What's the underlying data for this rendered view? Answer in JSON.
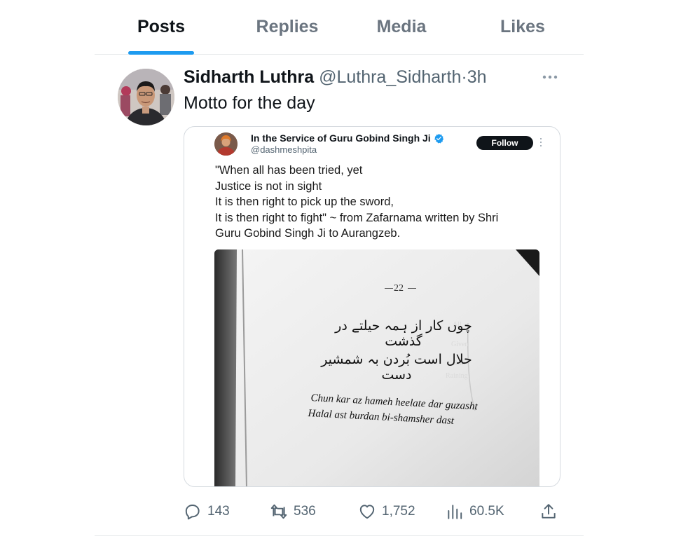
{
  "tabs": [
    {
      "label": "Posts",
      "active": true
    },
    {
      "label": "Replies",
      "active": false
    },
    {
      "label": "Media",
      "active": false
    },
    {
      "label": "Likes",
      "active": false
    }
  ],
  "accent_color": "#1d9bf0",
  "post": {
    "author_name": "Sidharth Luthra",
    "author_handle": "@Luthra_Sidharth",
    "separator": "·",
    "time": "3h",
    "text": "Motto for the day",
    "more_icon": "more-horizontal-icon"
  },
  "quoted_post": {
    "author_name": "In the Service of Guru Gobind Singh Ji",
    "author_handle": "@dashmeshpita",
    "verified_icon": "verified-badge-icon",
    "follow_label": "Follow",
    "text_lines": [
      "\"When all has been tried, yet",
      "Justice is not in sight",
      "It is then right to pick up the sword,",
      "It is then right to fight\" ~ from Zafarnama written by Shri",
      "Guru Gobind Singh Ji to Aurangzeb."
    ],
    "image": {
      "page_number": "22",
      "urdu_line_1": "چوں کار از ہمہ حیلتے در گذشت",
      "urdu_line_2": "حلال است بُردن بہ شمشیر دست",
      "translit_line_1": "Chun kar az hameh heelate dar guzasht",
      "translit_line_2": "Halal ast burdan bi-shamsher dast"
    }
  },
  "actions": {
    "replies": "143",
    "reposts": "536",
    "likes": "1,752",
    "views": "60.5K",
    "reply_icon": "reply-icon",
    "repost_icon": "repost-icon",
    "like_icon": "heart-icon",
    "views_icon": "views-chart-icon",
    "share_icon": "share-icon"
  }
}
